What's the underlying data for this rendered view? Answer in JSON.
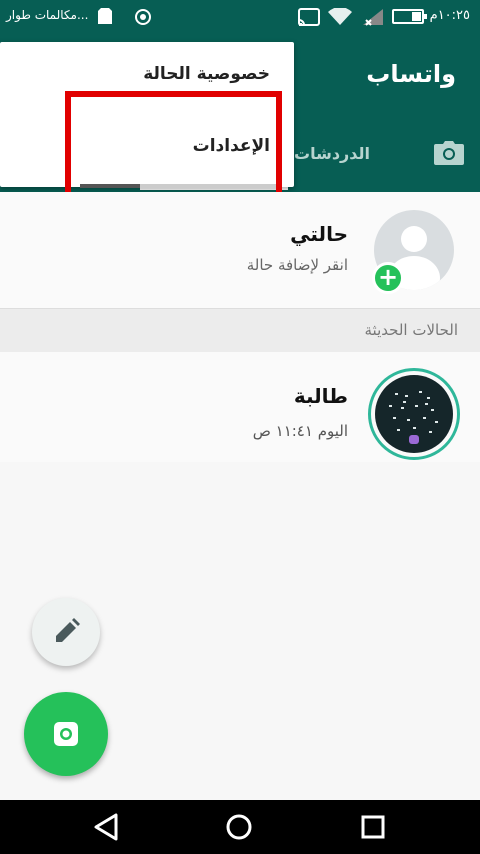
{
  "status_bar": {
    "carrier": "مكالمات طوار...",
    "time": "١٠:٢٥م",
    "battery_level": 0.35
  },
  "app_bar": {
    "title": "واتساب",
    "chats_tab": "الدردشات",
    "camera_tab_icon": "camera-icon"
  },
  "menu": {
    "items": [
      {
        "label": "خصوصية الحالة"
      },
      {
        "label": "الإعدادات"
      }
    ]
  },
  "my_status": {
    "name": "حالتي",
    "subtitle": "انقر لإضافة حالة"
  },
  "recent_section": {
    "title": "الحالات الحديثة"
  },
  "recent_items": [
    {
      "name": "طالبة",
      "time": "اليوم ١١:٤١ ص"
    }
  ],
  "colors": {
    "brand": "#075e54",
    "accent": "#25c15a",
    "highlight": "#e10000"
  }
}
